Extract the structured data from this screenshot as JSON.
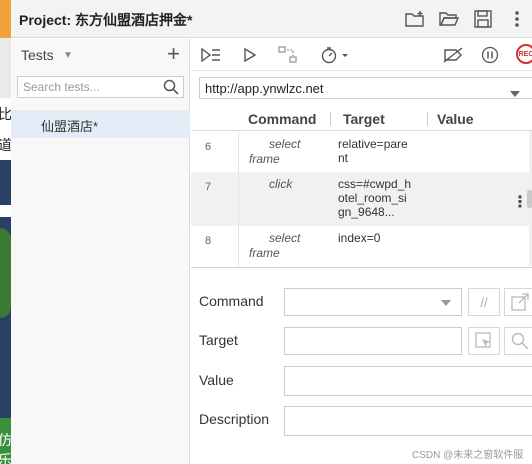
{
  "window": {
    "title": "Project:  东方仙盟酒店押金*"
  },
  "background_window": {
    "chars": [
      "比",
      "道",
      "仿",
      "乐"
    ]
  },
  "sidebar": {
    "tests_label": "Tests",
    "search_placeholder": "Search tests...",
    "suites": [
      {
        "name": "仙盟酒店*"
      }
    ]
  },
  "toolbar": {
    "record_label": "REC"
  },
  "url": {
    "value": "http://app.ynwlzc.net"
  },
  "table": {
    "headers": {
      "command": "Command",
      "target": "Target",
      "value": "Value"
    },
    "rows": [
      {
        "num": "6",
        "command": "select frame",
        "target": "relative=parent",
        "value": ""
      },
      {
        "num": "7",
        "command": "click",
        "target": "css=#cwpd_hotel_room_sign_9648...",
        "value": ""
      },
      {
        "num": "8",
        "command": "select frame",
        "target": "index=0",
        "value": ""
      }
    ]
  },
  "editor": {
    "command_label": "Command",
    "target_label": "Target",
    "value_label": "Value",
    "description_label": "Description",
    "comment_button": "//"
  },
  "watermark": "CSDN @未来之窗软件服务"
}
